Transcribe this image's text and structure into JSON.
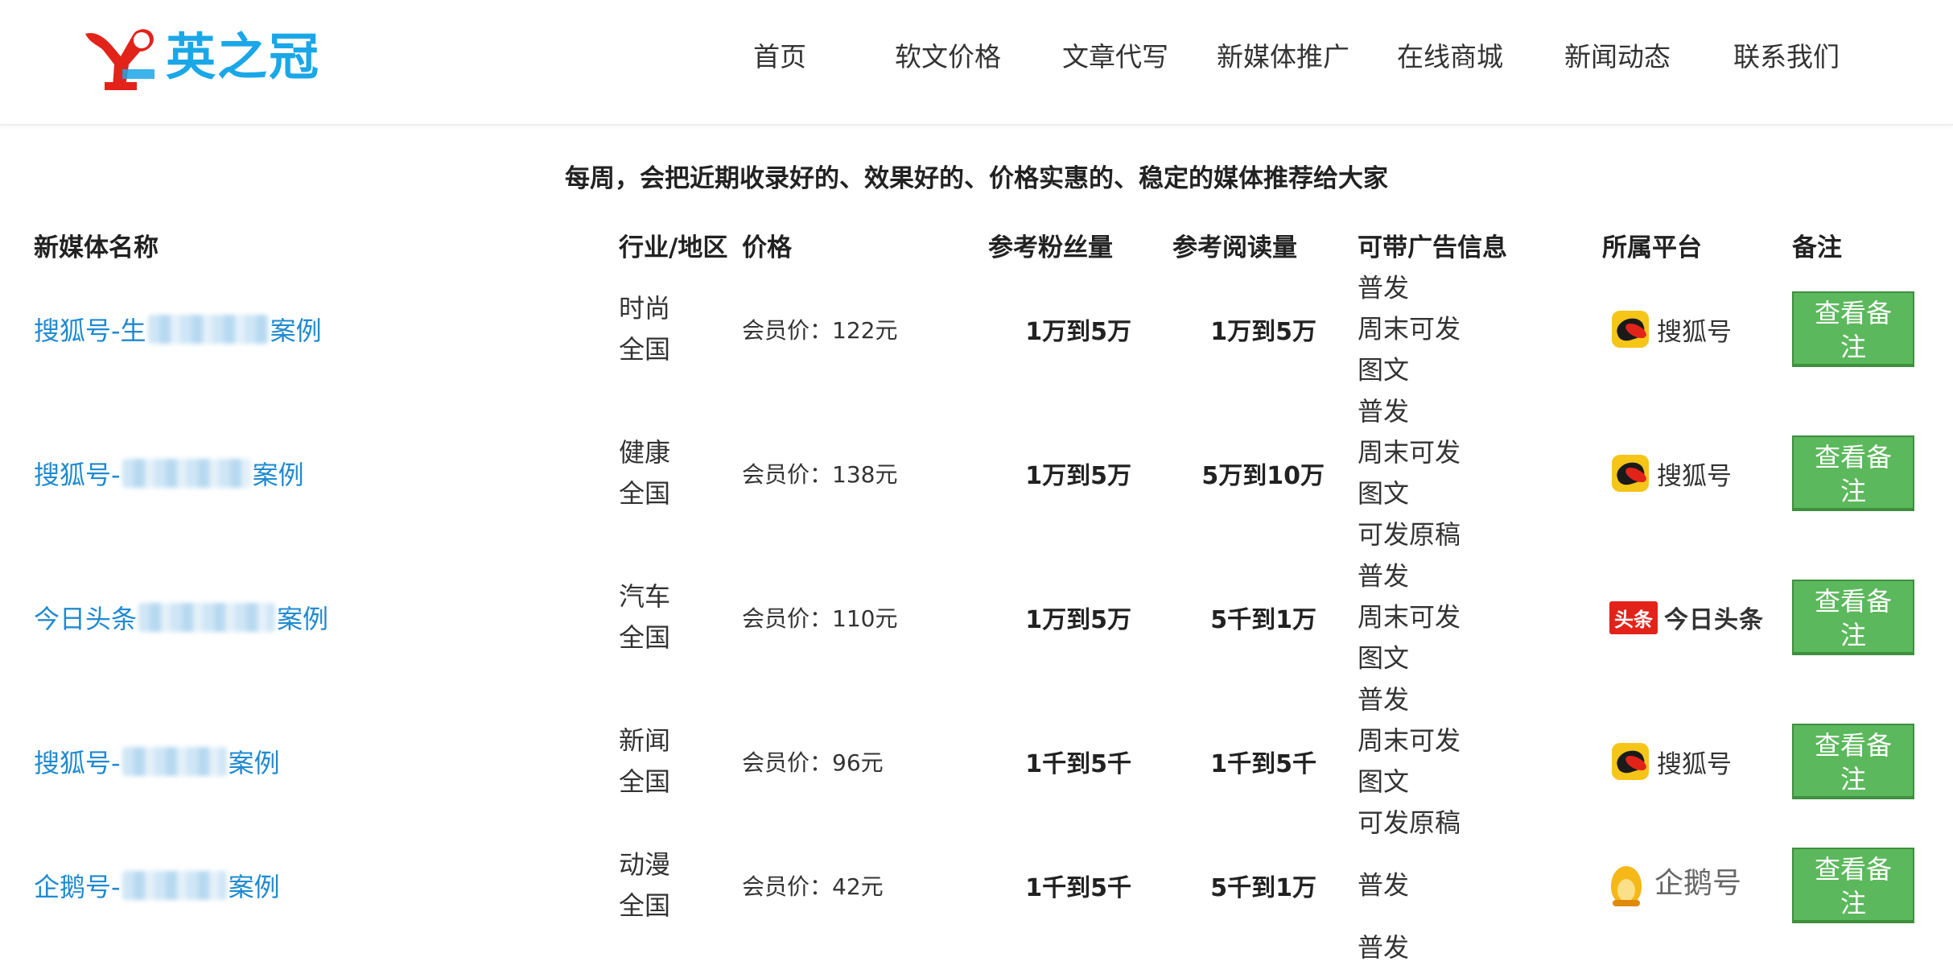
{
  "brand": {
    "name": "英之冠"
  },
  "nav": [
    "首页",
    "软文价格",
    "文章代写",
    "新媒体推广",
    "在线商城",
    "新闻动态",
    "联系我们"
  ],
  "banner": "每周，会把近期收录好的、效果好的、价格实惠的、稳定的媒体推荐给大家",
  "table": {
    "headers": [
      "新媒体名称",
      "行业/地区",
      "价格",
      "参考粉丝量",
      "参考阅读量",
      "可带广告信息",
      "所属平台",
      "备注"
    ],
    "rows": [
      {
        "name_prefix": "搜狐号-生",
        "name_tail": "",
        "case": "案例",
        "industry": "时尚",
        "region": "全国",
        "price": "会员价：122元",
        "fans": "1万到5万",
        "reads": "1万到5万",
        "ads": [
          "普发",
          "周末可发",
          "图文"
        ],
        "platform": "搜狐号",
        "platform_icon": "sohu-icon",
        "button": "查看备注"
      },
      {
        "name_prefix": "搜狐号-",
        "name_tail": "",
        "case": "案例",
        "industry": "健康",
        "region": "全国",
        "price": "会员价：138元",
        "fans": "1万到5万",
        "reads": "5万到10万",
        "ads": [
          "普发",
          "周末可发",
          "图文",
          "可发原稿"
        ],
        "platform": "搜狐号",
        "platform_icon": "sohu-icon",
        "button": "查看备注"
      },
      {
        "name_prefix": "今日头条",
        "name_tail": "",
        "case": "案例",
        "industry": "汽车",
        "region": "全国",
        "price": "会员价：110元",
        "fans": "1万到5万",
        "reads": "5千到1万",
        "ads": [
          "普发",
          "周末可发",
          "图文"
        ],
        "platform": "今日头条",
        "platform_badge": "头条",
        "platform_icon": "toutiao-icon",
        "button": "查看备注"
      },
      {
        "name_prefix": "搜狐号-",
        "name_tail": "",
        "case": "案例",
        "industry": "新闻",
        "region": "全国",
        "price": "会员价：96元",
        "fans": "1千到5千",
        "reads": "1千到5千",
        "ads": [
          "普发",
          "周末可发",
          "图文",
          "可发原稿"
        ],
        "platform": "搜狐号",
        "platform_icon": "sohu-icon",
        "button": "查看备注"
      },
      {
        "name_prefix": "企鹅号-",
        "name_tail": "",
        "case": "案例",
        "industry": "动漫",
        "region": "全国",
        "price": "会员价：42元",
        "fans": "1千到5千",
        "reads": "5千到1万",
        "ads": [
          "普发"
        ],
        "platform": "企鹅号",
        "platform_icon": "penguin-icon",
        "button": "查看备注"
      }
    ],
    "partial_row": {
      "ads": [
        "普发"
      ]
    }
  },
  "colors": {
    "link": "#1f8ad0",
    "button": "#5cb85c",
    "logo": "#1aa7e8"
  }
}
